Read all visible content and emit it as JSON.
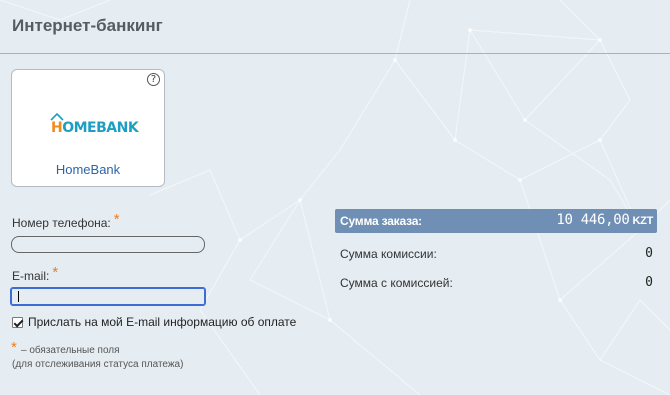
{
  "page": {
    "title": "Интернет-банкинг"
  },
  "bank_card": {
    "name": "HomeBank",
    "logo_text": "HOMEBANK",
    "help_icon": "question-circle-icon"
  },
  "form": {
    "phone_label": "Номер телефона:",
    "phone_value": "",
    "email_label": "E-mail:",
    "email_value": "",
    "required_mark": "*",
    "send_email_checkbox": {
      "label": "Прислать на мой E-mail информацию об оплате",
      "checked": true
    },
    "required_note": "– обязательные поля",
    "required_note_2": "(для отслеживания статуса платежа)"
  },
  "summary": {
    "order_label": "Сумма заказа:",
    "order_value": "10 446,00",
    "currency": "KZT",
    "commission_label": "Сумма комиссии:",
    "commission_value": "0",
    "total_label": "Сумма с комиссией:",
    "total_value": "0"
  },
  "colors": {
    "accent": "#6f8fb4",
    "required": "#f07d1e",
    "link": "#2d64a8",
    "logo_orange": "#f08b1d",
    "logo_blue": "#1d9fc4"
  }
}
